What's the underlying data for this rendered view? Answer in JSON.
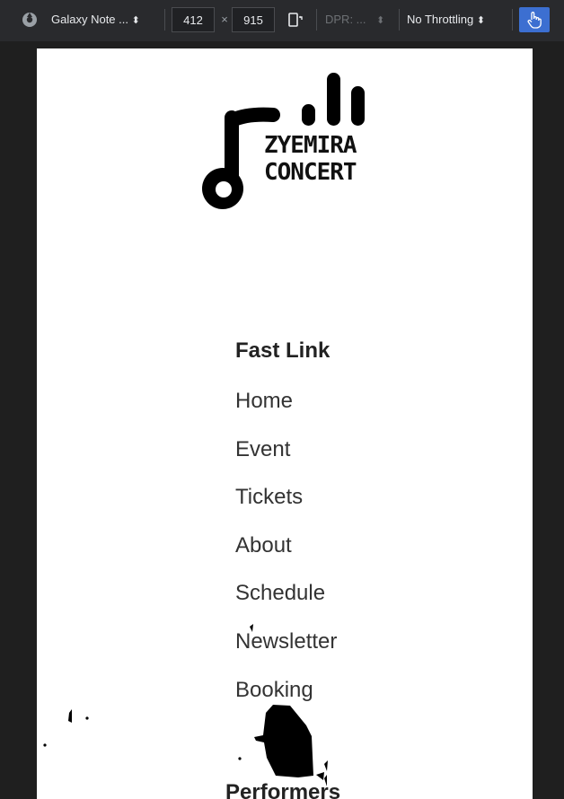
{
  "toolbar": {
    "device": "Galaxy Note ...",
    "device_arrow": "⬍",
    "width": "412",
    "times": "×",
    "height": "915",
    "dpr": "DPR: ...",
    "dpr_arrow": "⬍",
    "throttling": "No Throttling",
    "throttling_arrow": "⬍"
  },
  "logo": {
    "line1": "ZYEMIRA",
    "line2": "CONCERT"
  },
  "nav": {
    "title": "Fast Link",
    "items": [
      "Home",
      "Event",
      "Tickets",
      "About",
      "Schedule",
      "Newsletter",
      "Booking"
    ]
  },
  "performers": {
    "title": "Performers"
  },
  "colors": {
    "toolbar_bg": "#292a2d",
    "page_bg": "#1f1f1f",
    "viewport_bg": "#ffffff",
    "touch_accent": "#3c6fd1"
  }
}
